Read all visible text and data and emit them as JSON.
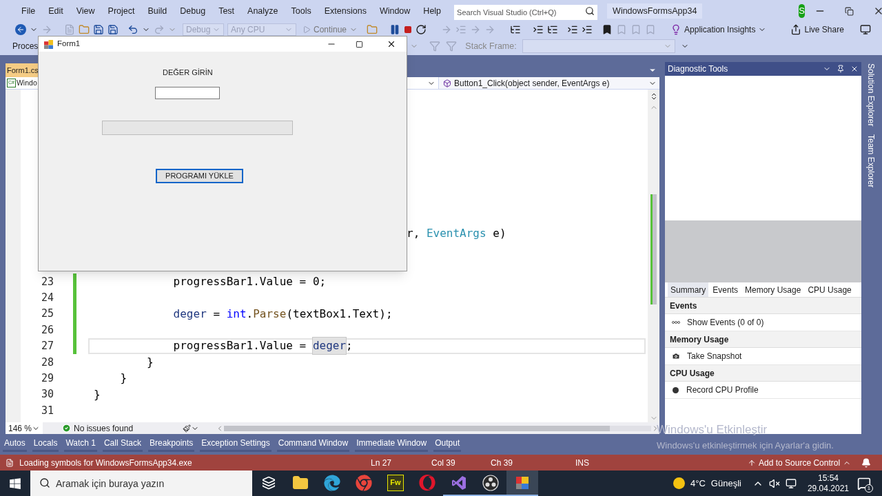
{
  "title_bar": {
    "menus": [
      "File",
      "Edit",
      "View",
      "Project",
      "Build",
      "Debug",
      "Test",
      "Analyze",
      "Tools",
      "Extensions",
      "Window",
      "Help"
    ],
    "search": {
      "placeholder": "Search Visual Studio (Ctrl+Q)"
    },
    "project": "WindowsFormsApp34",
    "avatar": "S"
  },
  "toolbar": {
    "configuration": "Debug",
    "platform": "Any CPU",
    "continue": "Continue",
    "insights": "Application Insights",
    "live_share": "Live Share"
  },
  "debug_toolbar": {
    "process_label": "Proces",
    "stack_frame_label": "Stack Frame:"
  },
  "editor": {
    "tab": "Form1.cs",
    "language_badge": "C#",
    "project_dropdown": "Windo",
    "member_dropdown": "Button1_Click(object sender, EventArgs e)",
    "covered_line": {
      "segments": [
        {
          "kind": "plain",
          "text": "r, ",
          "highlighted": false
        },
        {
          "kind": "type",
          "text": "EventArgs",
          "highlighted": false
        },
        {
          "kind": "plain",
          "text": " e)",
          "highlighted": false
        }
      ]
    },
    "lines": [
      {
        "number": "23",
        "changed": true,
        "current": false,
        "segments": [
          {
            "kind": "plain",
            "text": "            progressBar1.Value = 0;",
            "highlighted": false
          }
        ]
      },
      {
        "number": "24",
        "changed": true,
        "current": false
      },
      {
        "number": "25",
        "changed": true,
        "current": false,
        "segments": [
          {
            "kind": "variable",
            "text": "            deger",
            "highlighted": false
          },
          {
            "kind": "plain",
            "text": " = ",
            "highlighted": false
          },
          {
            "kind": "keyword",
            "text": "int",
            "highlighted": false
          },
          {
            "kind": "plain",
            "text": ".",
            "highlighted": false
          },
          {
            "kind": "method",
            "text": "Parse",
            "highlighted": false
          },
          {
            "kind": "plain",
            "text": "(textBox1.Text);",
            "highlighted": false
          }
        ]
      },
      {
        "number": "26",
        "changed": true,
        "current": false
      },
      {
        "number": "27",
        "changed": true,
        "current": true,
        "segments": [
          {
            "kind": "plain",
            "text": "            progressBar1.Value = ",
            "highlighted": false
          },
          {
            "kind": "variable",
            "text": "deger",
            "highlighted": true
          },
          {
            "kind": "plain",
            "text": ";",
            "highlighted": false
          }
        ]
      },
      {
        "number": "28",
        "changed": false,
        "current": false,
        "segments": [
          {
            "kind": "plain",
            "text": "        }",
            "highlighted": false
          }
        ]
      },
      {
        "number": "29",
        "changed": false,
        "current": false,
        "segments": [
          {
            "kind": "plain",
            "text": "    }",
            "highlighted": false
          }
        ]
      },
      {
        "number": "30",
        "changed": false,
        "current": false,
        "segments": [
          {
            "kind": "plain",
            "text": "}",
            "highlighted": false
          }
        ]
      },
      {
        "number": "31",
        "changed": false,
        "current": false
      }
    ],
    "zoom": "146 %",
    "issues": "No issues found"
  },
  "form": {
    "title": "Form1",
    "label": "DEĞER GİRİN",
    "progress": {
      "level": 0
    },
    "button": {
      "label": "PROGRAMI YÜKLE",
      "focused": true
    }
  },
  "diagnostic_tools": {
    "title": "Diagnostic Tools",
    "tabs": [
      {
        "label": "Summary",
        "selected": true
      },
      {
        "label": "Events",
        "selected": false
      },
      {
        "label": "Memory Usage",
        "selected": false
      },
      {
        "label": "CPU Usage",
        "selected": false
      }
    ],
    "sections": [
      {
        "title": "Events",
        "action": "Show Events (0 of 0)",
        "kind": "events"
      },
      {
        "title": "Memory Usage",
        "action": "Take Snapshot",
        "kind": "snapshot"
      },
      {
        "title": "CPU Usage",
        "action": "Record CPU Profile",
        "kind": "record"
      }
    ]
  },
  "side_tabs": [
    "Solution Explorer",
    "Team Explorer"
  ],
  "tool_tabs": [
    "Autos",
    "Locals",
    "Watch 1",
    "Call Stack",
    "Breakpoints",
    "Exception Settings",
    "Command Window",
    "Immediate Window",
    "Output"
  ],
  "status_bar": {
    "message": "Loading symbols for WindowsFormsApp34.exe",
    "line": "Ln 27",
    "col": "Col 39",
    "ch": "Ch 39",
    "mode": "INS",
    "source_control": "Add to Source Control"
  },
  "activation_notice": {
    "title": "Windows'u Etkinleştir",
    "text": "Windows'u etkinleştirmek için Ayarlar'a gidin."
  },
  "taskbar": {
    "search": {
      "placeholder": "Aramak için buraya yazın"
    },
    "apps": [
      {
        "kind": "task-view",
        "running": false,
        "active": false
      },
      {
        "kind": "explorer",
        "running": false,
        "active": false
      },
      {
        "kind": "edge",
        "running": false,
        "active": false
      },
      {
        "kind": "chrome",
        "running": false,
        "active": false
      },
      {
        "kind": "fireworks",
        "label": "Fw",
        "running": false,
        "active": false
      },
      {
        "kind": "opera",
        "running": false,
        "active": false
      },
      {
        "kind": "visual-studio",
        "running": true,
        "active": false
      },
      {
        "kind": "obs",
        "running": true,
        "active": false
      },
      {
        "kind": "form-app",
        "running": true,
        "active": true
      }
    ],
    "weather": {
      "temperature": "4°C",
      "condition": "Güneşli"
    },
    "time": "15:54",
    "date": "29.04.2021",
    "notifications": "1"
  }
}
